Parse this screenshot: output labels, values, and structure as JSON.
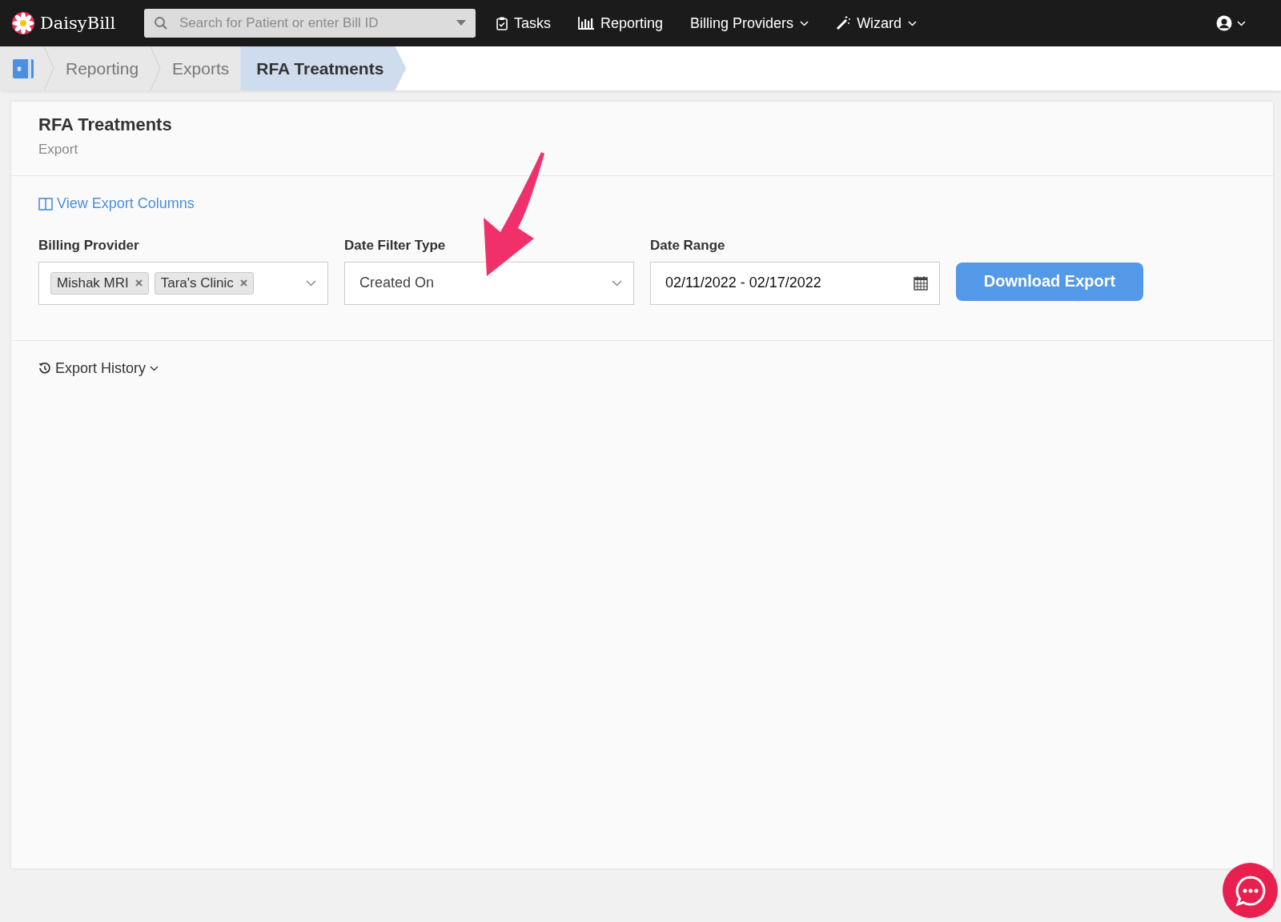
{
  "navbar": {
    "brand": "DaisyBill",
    "search": {
      "placeholder": "Search for Patient or enter Bill ID"
    },
    "items": [
      {
        "label": "Tasks",
        "kind": "tasks",
        "dropdown": false
      },
      {
        "label": "Reporting",
        "kind": "chart",
        "dropdown": false
      },
      {
        "label": "Billing Providers",
        "kind": "plain",
        "dropdown": true
      },
      {
        "label": "Wizard",
        "kind": "wand",
        "dropdown": true
      }
    ]
  },
  "breadcrumbs": [
    {
      "label": "Reporting",
      "selected": false
    },
    {
      "label": "Exports",
      "selected": false
    },
    {
      "label": "RFA Treatments",
      "selected": true
    }
  ],
  "page": {
    "title": "RFA Treatments",
    "subtitle": "Export",
    "columns_link": "View Export Columns",
    "filters": {
      "billing_provider": {
        "label": "Billing Provider",
        "tags": [
          "Mishak MRI",
          "Tara's Clinic"
        ]
      },
      "date_filter_type": {
        "label": "Date Filter Type",
        "value": "Created On"
      },
      "date_range": {
        "label": "Date Range",
        "value": "02/11/2022 - 02/17/2022"
      }
    },
    "download_button": "Download Export",
    "history": {
      "label": "Export History",
      "expanded": false
    }
  }
}
